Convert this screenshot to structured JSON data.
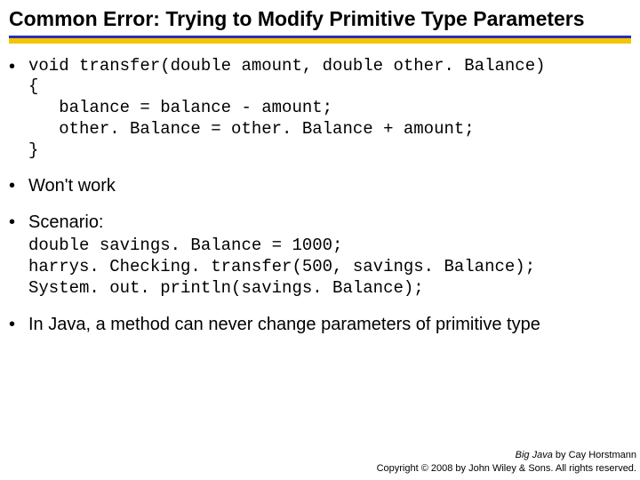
{
  "title": "Common Error: Trying to Modify Primitive Type Parameters",
  "bullets": {
    "b1": {
      "sig": "void transfer(double amount, double other. Balance)",
      "l1": "{",
      "l2": "   balance = balance - amount;",
      "l3": "   other. Balance = other. Balance + amount;",
      "l4": "}"
    },
    "b2": "Won't work",
    "b3": "Scenario:",
    "b3code": {
      "l1": "double savings. Balance = 1000;",
      "l2": "harrys. Checking. transfer(500, savings. Balance);",
      "l3": "System. out. println(savings. Balance);"
    },
    "b4": "In Java, a method can never change parameters of primitive type"
  },
  "footer": {
    "book": "Big Java",
    "by": " by Cay Horstmann",
    "copy": "Copyright © 2008 by John Wiley & Sons.  All rights reserved."
  }
}
